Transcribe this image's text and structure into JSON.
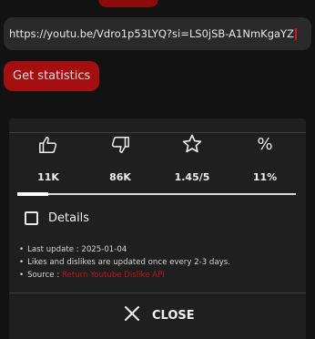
{
  "url_input": {
    "value": "https://youtu.be/Vdro1p53LYQ?si=LS0jSB-A1NmKgaYZ"
  },
  "actions": {
    "get_statistics": "Get statistics"
  },
  "stats": {
    "likes": {
      "icon": "thumbs-up-icon",
      "value": "11K"
    },
    "dislikes": {
      "icon": "thumbs-down-icon",
      "value": "86K"
    },
    "rating": {
      "icon": "star-icon",
      "value": "1.45/5"
    },
    "ratio": {
      "icon": "percent-icon",
      "symbol": "%",
      "value": "11%"
    }
  },
  "rating_bar": {
    "fill_percent": 11
  },
  "details": {
    "label": "Details",
    "checked": false
  },
  "info": {
    "last_update": "Last update : 2025-01-04",
    "refresh_note": "Likes and dislikes are updated once every 2-3 days.",
    "source_prefix": "Source : ",
    "source_link": "Return Youtube Dislike API"
  },
  "dialog": {
    "close_label": "CLOSE"
  },
  "colors": {
    "accent": "#a40f0f",
    "link": "#c41414",
    "background": "#121212",
    "dialog": "#1f1f1f"
  }
}
